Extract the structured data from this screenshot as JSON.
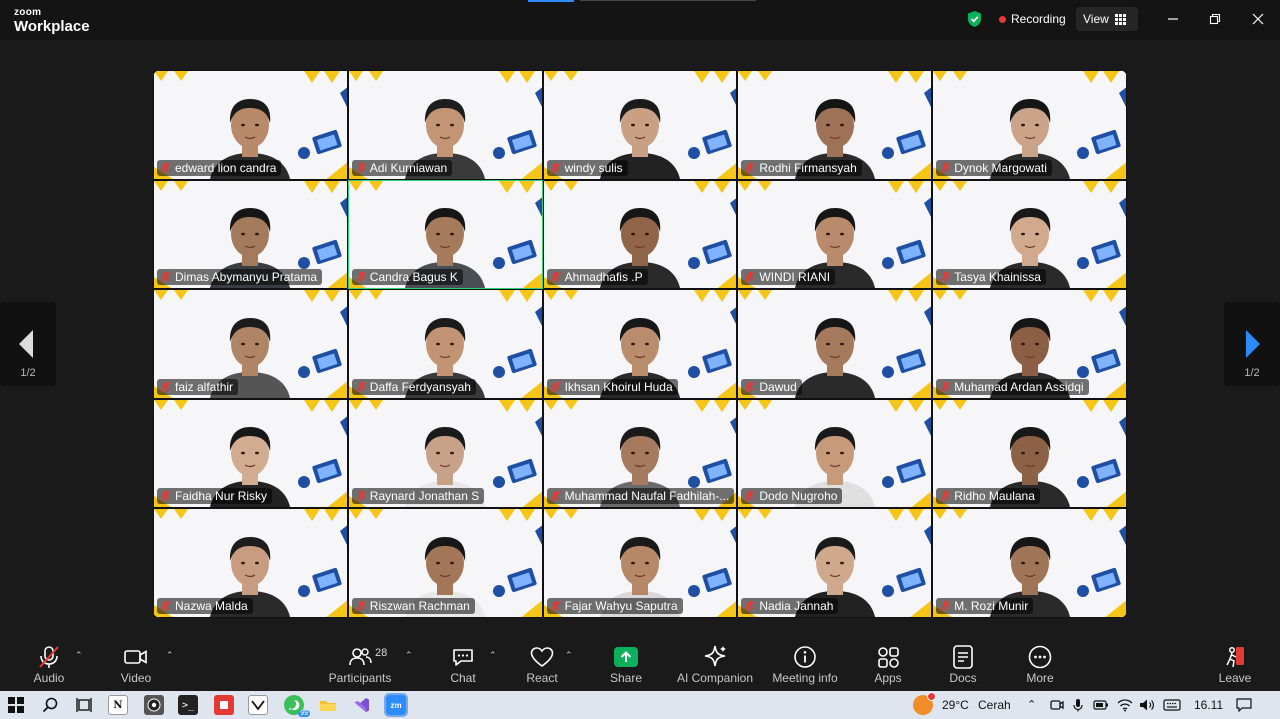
{
  "app": {
    "brand_small": "zoom",
    "brand_large": "Workplace"
  },
  "topbar": {
    "recording_label": "Recording",
    "view_label": "View"
  },
  "participants": [
    {
      "name": "edward lion candra",
      "skin": "#b88a6a",
      "hair": "#1a1a1a",
      "shirt": "#2a2a2a"
    },
    {
      "name": "Adi Kurniawan",
      "skin": "#c49574",
      "hair": "#1e1e1e",
      "shirt": "#3a3a3a"
    },
    {
      "name": "windy sulis",
      "skin": "#c9a084",
      "hair": "#1b1b1b",
      "shirt": "#222"
    },
    {
      "name": "Rodhi Firmansyah",
      "skin": "#9e7256",
      "hair": "#151515",
      "shirt": "#2b2b2b"
    },
    {
      "name": "Dynok Margowati",
      "skin": "#caa388",
      "hair": "#161616",
      "shirt": "#2d2d2d"
    },
    {
      "name": "Dimas Abymanyu Pratama",
      "skin": "#a47a5c",
      "hair": "#161616",
      "shirt": "#3a3e44"
    },
    {
      "name": "Candra Bagus K",
      "skin": "#a67b5b",
      "hair": "#161616",
      "shirt": "#4a4f56"
    },
    {
      "name": "Ahmadhafis .P",
      "skin": "#8f6448",
      "hair": "#171717",
      "shirt": "#2a2a2a"
    },
    {
      "name": "WINDI RIANI",
      "skin": "#b98a6b",
      "hair": "#161616",
      "shirt": "#2a2a2a"
    },
    {
      "name": "Tasya Khainissa",
      "skin": "#d1aa8e",
      "hair": "#181818",
      "shirt": "#2a2a2a"
    },
    {
      "name": "faiz alfathir",
      "skin": "#b08566",
      "hair": "#1c1c1c",
      "shirt": "#555"
    },
    {
      "name": "Daffa Ferdyansyah",
      "skin": "#c29473",
      "hair": "#1b1b1b",
      "shirt": "#3a3a3a"
    },
    {
      "name": "Ikhsan Khoirul Huda",
      "skin": "#b98c6c",
      "hair": "#171717",
      "shirt": "#2a2a2a"
    },
    {
      "name": "Dawud",
      "skin": "#a57a5c",
      "hair": "#161616",
      "shirt": "#2a2a2a"
    },
    {
      "name": "Muhamad Ardan Assidqi",
      "skin": "#8c5f44",
      "hair": "#161616",
      "shirt": "#2a2a2a"
    },
    {
      "name": "Faidha Nur Risky",
      "skin": "#d2ac90",
      "hair": "#171717",
      "shirt": "#222"
    },
    {
      "name": "Raynard Jonathan S",
      "skin": "#c8a288",
      "hair": "#1a1a1a",
      "shirt": "#e8e8e8"
    },
    {
      "name": "Muhammad Naufal Fadhilah-...",
      "skin": "#a57a5e",
      "hair": "#1a1a1a",
      "shirt": "#6b6b6b"
    },
    {
      "name": "Dodo Nugroho",
      "skin": "#c79a7a",
      "hair": "#1a1a1a",
      "shirt": "#e0e0e0"
    },
    {
      "name": "Ridho Maulana",
      "skin": "#8d6146",
      "hair": "#171717",
      "shirt": "#2a2a2a"
    },
    {
      "name": "Nazwa Malda",
      "skin": "#c89c80",
      "hair": "#1d1d1d",
      "shirt": "#2a2a2a"
    },
    {
      "name": "Riszwan Rachman",
      "skin": "#a47658",
      "hair": "#171717",
      "shirt": "#e8e8e8"
    },
    {
      "name": "Fajar Wahyu Saputra",
      "skin": "#b68868",
      "hair": "#1a1a1a",
      "shirt": "#d8d8d8"
    },
    {
      "name": "Nadia Jannah",
      "skin": "#d0a98c",
      "hair": "#1a1a1a",
      "shirt": "#222"
    },
    {
      "name": "M. Rozi Munir",
      "skin": "#a07456",
      "hair": "#161616",
      "shirt": "#2a2a2a"
    }
  ],
  "pagination": {
    "left": "1/2",
    "right": "1/2"
  },
  "toolbar": {
    "audio": "Audio",
    "video": "Video",
    "participants": "Participants",
    "participants_count": "28",
    "chat": "Chat",
    "react": "React",
    "share": "Share",
    "ai_companion": "AI Companion",
    "meeting_info": "Meeting info",
    "apps": "Apps",
    "docs": "Docs",
    "more": "More",
    "leave": "Leave"
  },
  "taskbar": {
    "weather_temp": "29°C",
    "weather_text": "Cerah",
    "time": "16.11",
    "whatsapp_badge": "99"
  },
  "colors": {
    "accent_green": "#2cd07a",
    "share_green": "#0bb05a",
    "nav_blue": "#2d8cff",
    "banner_yellow": "#f5c518",
    "banner_blue": "#1e4fa3"
  }
}
